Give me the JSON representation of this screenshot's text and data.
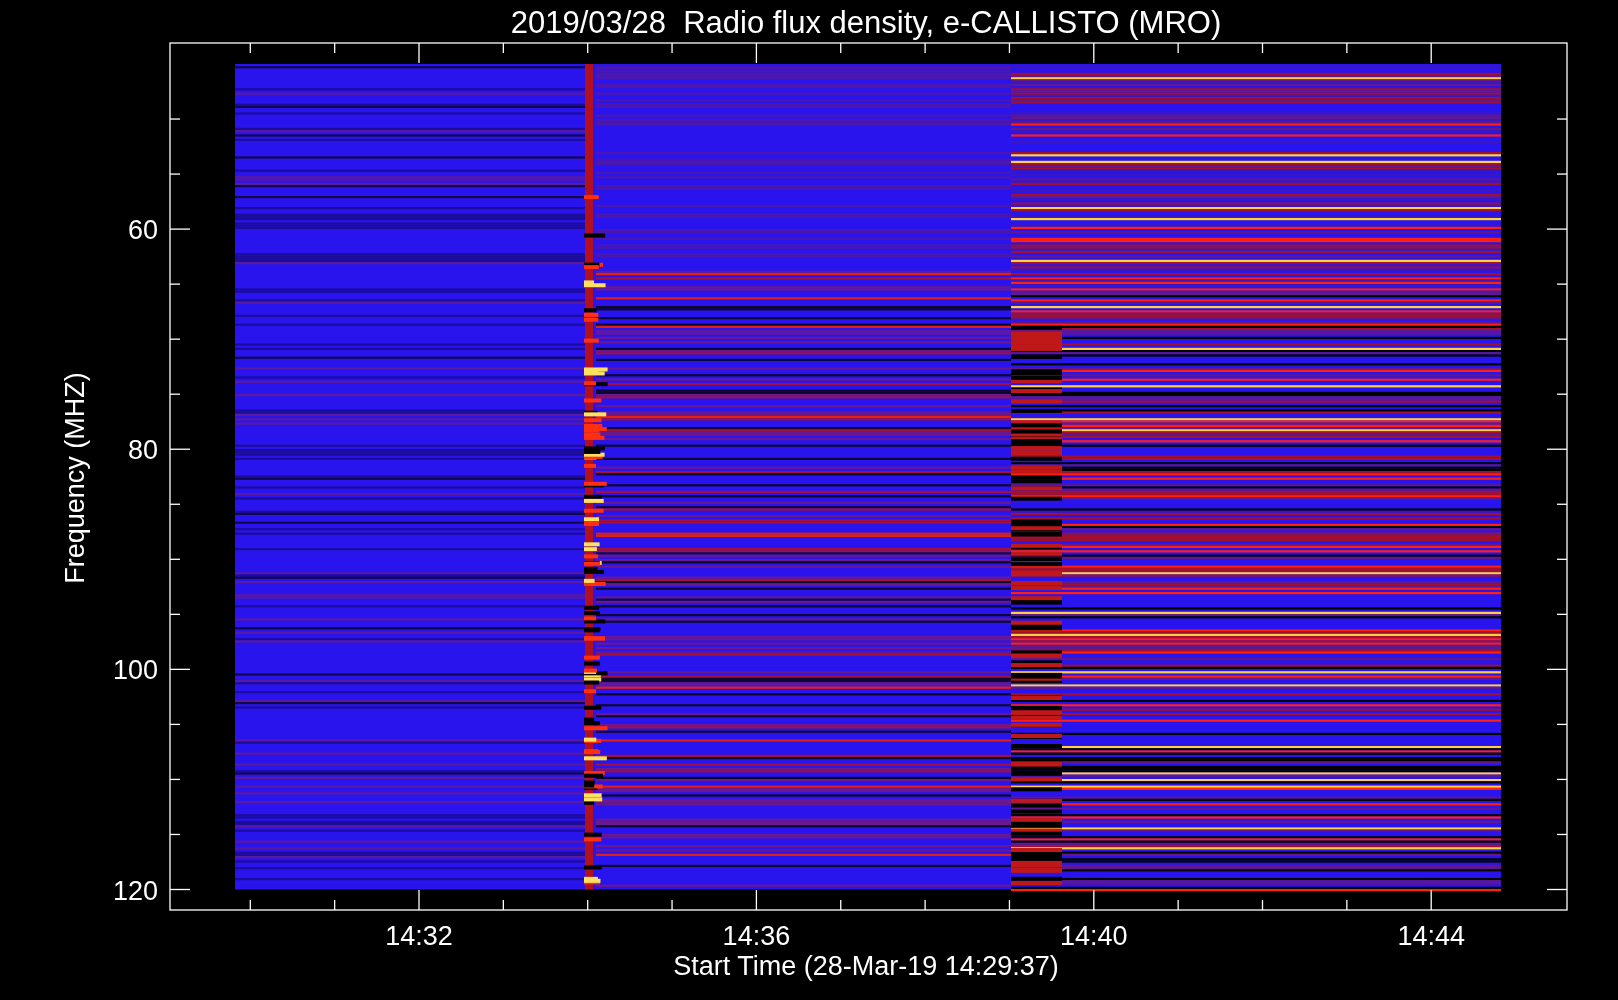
{
  "title": "2019/03/28  Radio flux density, e-CALLISTO (MRO)",
  "plot": {
    "ylabel": "Frequency (MHZ)",
    "xlabel": "Start Time (28-Mar-19 14:29:37)",
    "yticks": [
      "60",
      "80",
      "100",
      "120"
    ],
    "xticks": [
      "14:32",
      "14:36",
      "14:40",
      "14:44"
    ]
  }
}
